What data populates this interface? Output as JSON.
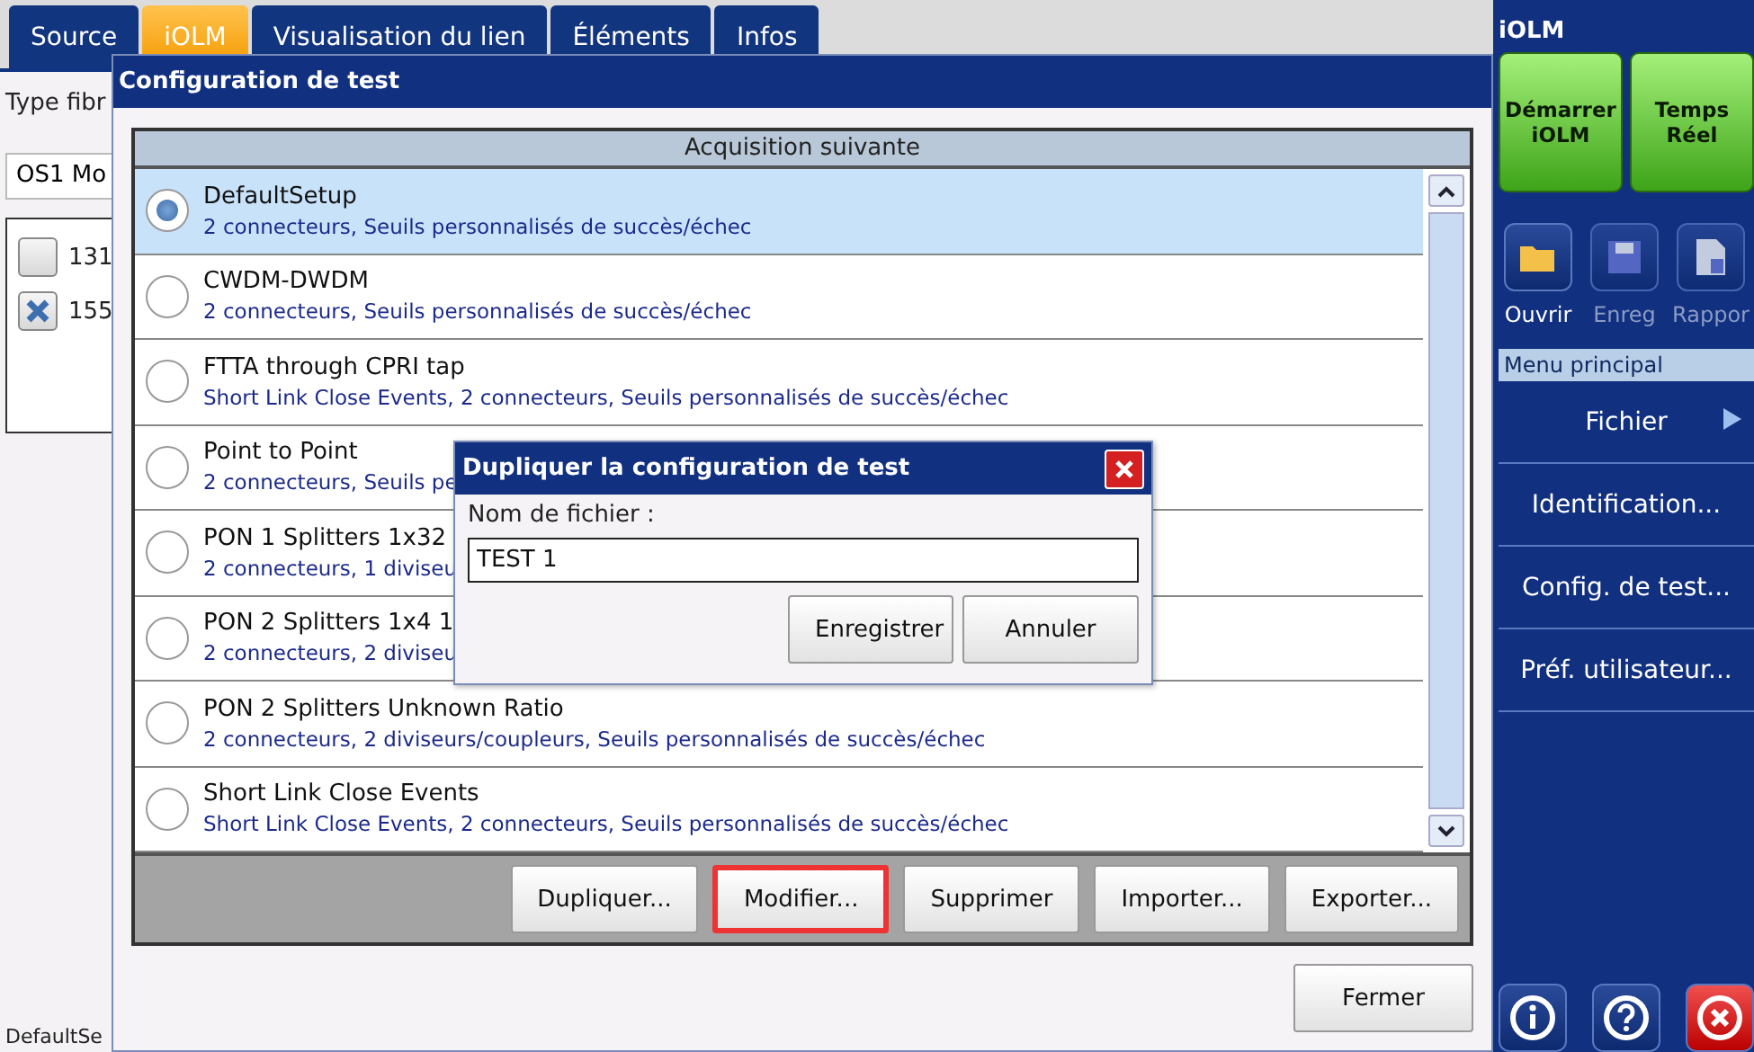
{
  "tabs": [
    {
      "label": "Source",
      "selected": false
    },
    {
      "label": "iOLM",
      "selected": true
    },
    {
      "label": "Visualisation du lien",
      "selected": false
    },
    {
      "label": "Éléments",
      "selected": false
    },
    {
      "label": "Infos",
      "selected": false
    }
  ],
  "background_panel": {
    "fiber_label": "Type fibr",
    "fiber_value": "OS1 Mo",
    "wavelengths": [
      {
        "label": "131",
        "checked": false
      },
      {
        "label": "155",
        "checked": true
      }
    ],
    "status": "DefaultSe"
  },
  "sidebar": {
    "title": "iOLM",
    "actions": [
      "Démarrer iOLM",
      "Temps Réel"
    ],
    "tools": [
      {
        "label": "Ouvrir",
        "kind": "folder",
        "disabled": false
      },
      {
        "label": "Enreg",
        "kind": "save",
        "disabled": true
      },
      {
        "label": "Rappor",
        "kind": "report",
        "disabled": true
      }
    ],
    "menu_title": "Menu principal",
    "menu": [
      {
        "label": "Fichier",
        "submenu": true
      },
      {
        "label": "Identification...",
        "submenu": false
      },
      {
        "label": "Config. de test...",
        "submenu": false
      },
      {
        "label": "Préf. utilisateur...",
        "submenu": false
      }
    ],
    "bottom": [
      {
        "kind": "info"
      },
      {
        "kind": "help"
      },
      {
        "kind": "close"
      }
    ]
  },
  "dialog": {
    "title": "Configuration de test",
    "list_header": "Acquisition suivante",
    "setups": [
      {
        "name": "DefaultSetup",
        "details": "2 connecteurs, Seuils personnalisés de succès/échec",
        "selected": true
      },
      {
        "name": "CWDM-DWDM",
        "details": "2 connecteurs, Seuils personnalisés de succès/échec",
        "selected": false
      },
      {
        "name": "FTTA through CPRI tap",
        "details": "Short Link Close Events, 2 connecteurs, Seuils personnalisés de succès/échec",
        "selected": false
      },
      {
        "name": "Point to Point",
        "details": "2 connecteurs, Seuils pe",
        "selected": false
      },
      {
        "name": "PON 1 Splitters 1x32",
        "details": "2 connecteurs, 1 diviseu",
        "selected": false
      },
      {
        "name": "PON 2 Splitters 1x4 1",
        "details": "2 connecteurs, 2 diviseu",
        "selected": false
      },
      {
        "name": "PON 2 Splitters Unknown Ratio",
        "details": "2 connecteurs, 2 diviseurs/coupleurs, Seuils personnalisés de succès/échec",
        "selected": false
      },
      {
        "name": "Short Link Close Events",
        "details": "Short Link Close Events, 2 connecteurs, Seuils personnalisés de succès/échec",
        "selected": false
      }
    ],
    "actions": [
      {
        "label": "Dupliquer...",
        "highlighted": false
      },
      {
        "label": "Modifier...",
        "highlighted": true
      },
      {
        "label": "Supprimer",
        "highlighted": false
      },
      {
        "label": "Importer...",
        "highlighted": false
      },
      {
        "label": "Exporter...",
        "highlighted": false
      }
    ],
    "close_button": "Fermer"
  },
  "duplicate_dialog": {
    "title": "Dupliquer la configuration de test",
    "field_label": "Nom de fichier :",
    "value": "TEST 1",
    "buttons": [
      "Enregistrer",
      "Annuler"
    ]
  }
}
